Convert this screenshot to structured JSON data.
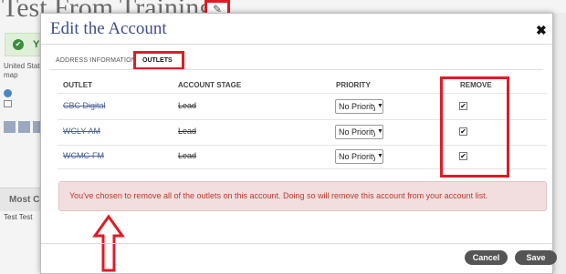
{
  "background": {
    "title": "Test From Training",
    "edit_icon": "pencil-icon",
    "notice_letter": "Y",
    "location_line1": "United State",
    "location_line2": "map",
    "section_title": "Most Co",
    "contact_text": "Test Test"
  },
  "modal": {
    "title": "Edit the Account",
    "close_label": "✖",
    "tabs": [
      {
        "label": "ADDRESS INFORMATION"
      },
      {
        "label": "OUTLETS"
      }
    ],
    "columns": {
      "outlet": "OUTLET",
      "stage": "ACCOUNT STAGE",
      "priority": "PRIORITY",
      "remove": "REMOVE"
    },
    "rows": [
      {
        "name": "CBC Digital",
        "stage": "Lead",
        "priority": "No Priority",
        "remove": true
      },
      {
        "name": "WCLY-AM",
        "stage": "Lead",
        "priority": "No Priority",
        "remove": true
      },
      {
        "name": "WCMC-FM",
        "stage": "Lead",
        "priority": "No Priority",
        "remove": true
      }
    ],
    "alert_message": "You've chosen to remove all of the outlets on this account. Doing so will remove this account from your account list.",
    "buttons": {
      "cancel": "Cancel",
      "save": "Save"
    }
  },
  "colors": {
    "annotation_red": "#e01b24",
    "title_blue": "#3f4f8a",
    "alert_bg": "#f2dede",
    "alert_text": "#c0392b",
    "button_bg": "#555555"
  }
}
